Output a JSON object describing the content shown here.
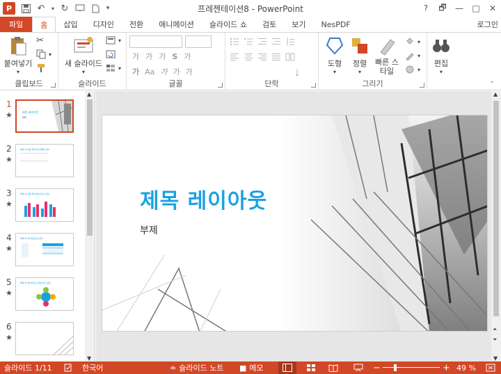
{
  "app": {
    "title": "프레젠테이션8 - PowerPoint",
    "icon_letter": "P",
    "accent_color": "#d24726",
    "title_color": "#1ba1e2"
  },
  "window_controls": {
    "help": "?",
    "restore": "🗗",
    "minimize": "—",
    "maximize": "□",
    "close": "✕"
  },
  "tabs": [
    {
      "label": "파일"
    },
    {
      "label": "홈"
    },
    {
      "label": "삽입"
    },
    {
      "label": "디자인"
    },
    {
      "label": "전환"
    },
    {
      "label": "애니메이션"
    },
    {
      "label": "슬라이드 쇼"
    },
    {
      "label": "검토"
    },
    {
      "label": "보기"
    },
    {
      "label": "NesPDF"
    }
  ],
  "login": "로그인",
  "ribbon": {
    "clipboard": {
      "paste": "붙여넣기",
      "label": "클립보드"
    },
    "slides": {
      "new_slide": "새 슬라이드",
      "label": "슬라이드"
    },
    "font": {
      "label": "글꼴",
      "grow": "가",
      "shrink": "가",
      "clear": "가",
      "strike": "S",
      "spacing": "가",
      "bold": "가",
      "italic": "가",
      "case": "Aa",
      "color": "가",
      "highlight": "가"
    },
    "paragraph": {
      "label": "단락"
    },
    "drawing": {
      "shape": "도형",
      "arrange": "정렬",
      "quick_style": "빠른 스타일",
      "label": "그리기"
    },
    "editing": {
      "edit": "편집"
    }
  },
  "thumbnails": [
    {
      "num": "1",
      "star": "★",
      "title": "제목 레이아웃",
      "sub": "부제"
    },
    {
      "num": "2",
      "star": "★",
      "title": "제목 및 내용 레이아웃(목록 포함)"
    },
    {
      "num": "3",
      "star": "★",
      "title": "제목 및 내용 레이아웃(차트 포함)"
    },
    {
      "num": "4",
      "star": "★",
      "title": "제목 및 레이아웃(표 포함)"
    },
    {
      "num": "5",
      "star": "★",
      "title": "제목 및 레이아웃(스마트아트 포함)"
    },
    {
      "num": "6",
      "star": "★"
    }
  ],
  "slide": {
    "title": "제목 레이아웃",
    "subtitle": "부제"
  },
  "status": {
    "slide_info": "슬라이드 1/11",
    "language": "한국어",
    "notes": "슬라이드 노트",
    "comments": "메모",
    "zoom_minus": "−",
    "zoom_plus": "+",
    "zoom_level": "49 %",
    "zoom_fraction": 0.49
  }
}
